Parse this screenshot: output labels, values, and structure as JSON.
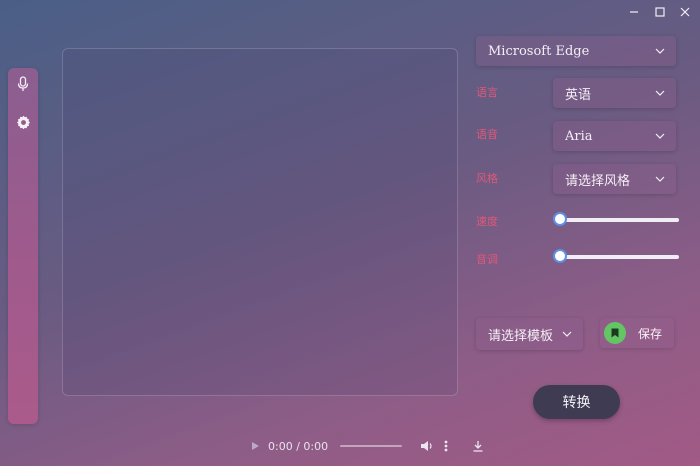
{
  "window": {
    "minimize_icon": "minimize-icon",
    "maximize_icon": "maximize-icon",
    "close_icon": "close-icon"
  },
  "sidebar": {
    "items": [
      {
        "icon": "microphone-icon"
      },
      {
        "icon": "gear-icon"
      }
    ]
  },
  "editor": {
    "text": ""
  },
  "settings": {
    "engine": "Microsoft Edge",
    "language_label": "语言",
    "language_value": "英语",
    "voice_label": "语音",
    "voice_value": "Aria",
    "style_label": "风格",
    "style_value": "请选择风格",
    "rate_label": "速度",
    "rate_level": 0,
    "pitch_label": "音调",
    "pitch_level": 0
  },
  "template": {
    "value": "请选择模板",
    "save_label": "保存"
  },
  "convert_label": "转换",
  "player": {
    "time": "0:00 / 0:00"
  },
  "colors": {
    "accent_label": "#e0587a",
    "save_green": "#63c564",
    "slider_thumb_border": "#5f8ee6",
    "convert_bg": "#3e3b53"
  }
}
